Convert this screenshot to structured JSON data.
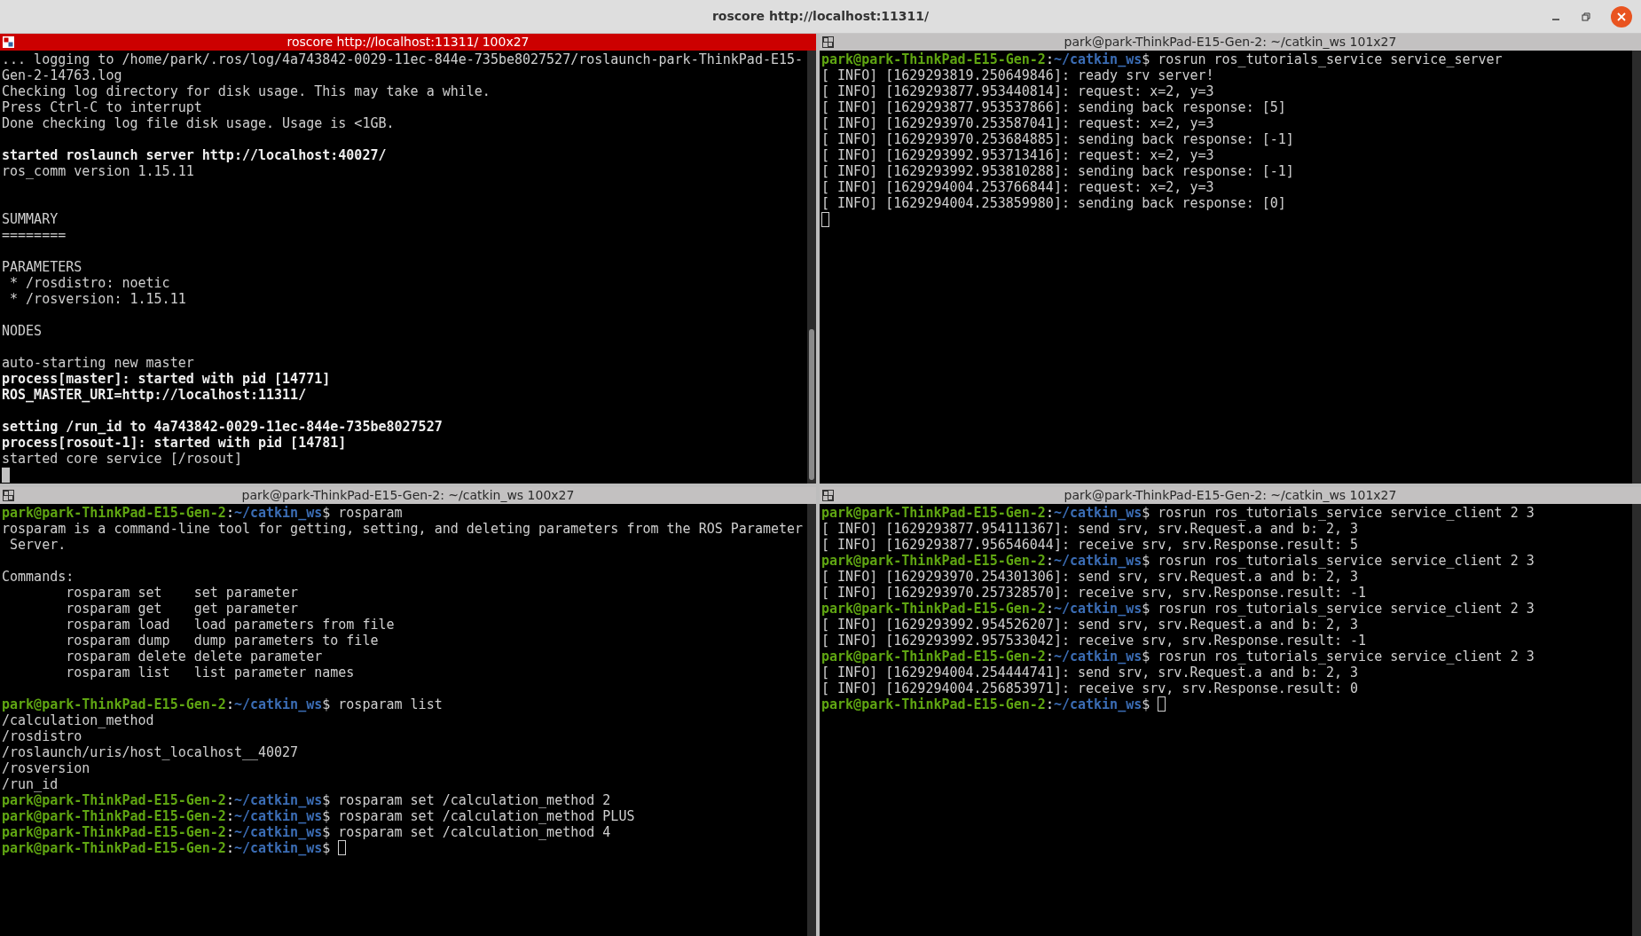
{
  "window": {
    "title": "roscore http://localhost:11311/"
  },
  "panes": [
    {
      "title": "roscore http://localhost:11311/ 100x27",
      "active": true,
      "scroll": true,
      "lines": [
        {
          "kind": "text",
          "text": "... logging to /home/park/.ros/log/4a743842-0029-11ec-844e-735be8027527/roslaunch-park-ThinkPad-E15-",
          "bold": false
        },
        {
          "kind": "text",
          "text": "Gen-2-14763.log",
          "bold": false
        },
        {
          "kind": "text",
          "text": "Checking log directory for disk usage. This may take a while.",
          "bold": false
        },
        {
          "kind": "text",
          "text": "Press Ctrl-C to interrupt",
          "bold": false
        },
        {
          "kind": "text",
          "text": "Done checking log file disk usage. Usage is <1GB.",
          "bold": false
        },
        {
          "kind": "blank"
        },
        {
          "kind": "text",
          "text": "started roslaunch server http://localhost:40027/",
          "bold": true
        },
        {
          "kind": "text",
          "text": "ros_comm version 1.15.11",
          "bold": false
        },
        {
          "kind": "blank"
        },
        {
          "kind": "blank"
        },
        {
          "kind": "text",
          "text": "SUMMARY",
          "bold": false
        },
        {
          "kind": "text",
          "text": "========",
          "bold": false
        },
        {
          "kind": "blank"
        },
        {
          "kind": "text",
          "text": "PARAMETERS",
          "bold": false
        },
        {
          "kind": "text",
          "text": " * /rosdistro: noetic",
          "bold": false
        },
        {
          "kind": "text",
          "text": " * /rosversion: 1.15.11",
          "bold": false
        },
        {
          "kind": "blank"
        },
        {
          "kind": "text",
          "text": "NODES",
          "bold": false
        },
        {
          "kind": "blank"
        },
        {
          "kind": "text",
          "text": "auto-starting new master",
          "bold": false
        },
        {
          "kind": "text",
          "text": "process[master]: started with pid [14771]",
          "bold": true
        },
        {
          "kind": "text",
          "text": "ROS_MASTER_URI=http://localhost:11311/",
          "bold": true
        },
        {
          "kind": "blank"
        },
        {
          "kind": "text",
          "text": "setting /run_id to 4a743842-0029-11ec-844e-735be8027527",
          "bold": true
        },
        {
          "kind": "text",
          "text": "process[rosout-1]: started with pid [14781]",
          "bold": true
        },
        {
          "kind": "text",
          "text": "started core service [/rosout]",
          "bold": false
        },
        {
          "kind": "cursor"
        }
      ]
    },
    {
      "title": "park@park-ThinkPad-E15-Gen-2: ~/catkin_ws 101x27",
      "active": false,
      "scroll": false,
      "lines": [
        {
          "kind": "prompt",
          "user": "park@park-ThinkPad-E15-Gen-2",
          "sep": ":",
          "path": "~/catkin_ws",
          "sign": "$",
          "command": " rosrun ros_tutorials_service service_server",
          "cursor": false
        },
        {
          "kind": "text",
          "text": "[ INFO] [1629293819.250649846]: ready srv server!",
          "bold": false
        },
        {
          "kind": "text",
          "text": "[ INFO] [1629293877.953440814]: request: x=2, y=3",
          "bold": false
        },
        {
          "kind": "text",
          "text": "[ INFO] [1629293877.953537866]: sending back response: [5]",
          "bold": false
        },
        {
          "kind": "text",
          "text": "[ INFO] [1629293970.253587041]: request: x=2, y=3",
          "bold": false
        },
        {
          "kind": "text",
          "text": "[ INFO] [1629293970.253684885]: sending back response: [-1]",
          "bold": false
        },
        {
          "kind": "text",
          "text": "[ INFO] [1629293992.953713416]: request: x=2, y=3",
          "bold": false
        },
        {
          "kind": "text",
          "text": "[ INFO] [1629293992.953810288]: sending back response: [-1]",
          "bold": false
        },
        {
          "kind": "text",
          "text": "[ INFO] [1629294004.253766844]: request: x=2, y=3",
          "bold": false
        },
        {
          "kind": "text",
          "text": "[ INFO] [1629294004.253859980]: sending back response: [0]",
          "bold": false
        },
        {
          "kind": "cursor"
        }
      ]
    },
    {
      "title": "park@park-ThinkPad-E15-Gen-2: ~/catkin_ws 100x27",
      "active": false,
      "scroll": false,
      "lines": [
        {
          "kind": "prompt",
          "user": "park@park-ThinkPad-E15-Gen-2",
          "sep": ":",
          "path": "~/catkin_ws",
          "sign": "$",
          "command": " rosparam",
          "cursor": false
        },
        {
          "kind": "text",
          "text": "rosparam is a command-line tool for getting, setting, and deleting parameters from the ROS Parameter",
          "bold": false
        },
        {
          "kind": "text",
          "text": " Server.",
          "bold": false
        },
        {
          "kind": "blank"
        },
        {
          "kind": "text",
          "text": "Commands:",
          "bold": false
        },
        {
          "kind": "text",
          "text": "        rosparam set    set parameter",
          "bold": false
        },
        {
          "kind": "text",
          "text": "        rosparam get    get parameter",
          "bold": false
        },
        {
          "kind": "text",
          "text": "        rosparam load   load parameters from file",
          "bold": false
        },
        {
          "kind": "text",
          "text": "        rosparam dump   dump parameters to file",
          "bold": false
        },
        {
          "kind": "text",
          "text": "        rosparam delete delete parameter",
          "bold": false
        },
        {
          "kind": "text",
          "text": "        rosparam list   list parameter names",
          "bold": false
        },
        {
          "kind": "blank"
        },
        {
          "kind": "prompt",
          "user": "park@park-ThinkPad-E15-Gen-2",
          "sep": ":",
          "path": "~/catkin_ws",
          "sign": "$",
          "command": " rosparam list",
          "cursor": false
        },
        {
          "kind": "text",
          "text": "/calculation_method",
          "bold": false
        },
        {
          "kind": "text",
          "text": "/rosdistro",
          "bold": false
        },
        {
          "kind": "text",
          "text": "/roslaunch/uris/host_localhost__40027",
          "bold": false
        },
        {
          "kind": "text",
          "text": "/rosversion",
          "bold": false
        },
        {
          "kind": "text",
          "text": "/run_id",
          "bold": false
        },
        {
          "kind": "prompt",
          "user": "park@park-ThinkPad-E15-Gen-2",
          "sep": ":",
          "path": "~/catkin_ws",
          "sign": "$",
          "command": " rosparam set /calculation_method 2",
          "cursor": false
        },
        {
          "kind": "prompt",
          "user": "park@park-ThinkPad-E15-Gen-2",
          "sep": ":",
          "path": "~/catkin_ws",
          "sign": "$",
          "command": " rosparam set /calculation_method PLUS",
          "cursor": false
        },
        {
          "kind": "prompt",
          "user": "park@park-ThinkPad-E15-Gen-2",
          "sep": ":",
          "path": "~/catkin_ws",
          "sign": "$",
          "command": " rosparam set /calculation_method 4",
          "cursor": false
        },
        {
          "kind": "prompt",
          "user": "park@park-ThinkPad-E15-Gen-2",
          "sep": ":",
          "path": "~/catkin_ws",
          "sign": "$",
          "cursor": true
        }
      ]
    },
    {
      "title": "park@park-ThinkPad-E15-Gen-2: ~/catkin_ws 101x27",
      "active": false,
      "scroll": false,
      "lines": [
        {
          "kind": "prompt",
          "user": "park@park-ThinkPad-E15-Gen-2",
          "sep": ":",
          "path": "~/catkin_ws",
          "sign": "$",
          "command": " rosrun ros_tutorials_service service_client 2 3",
          "cursor": false
        },
        {
          "kind": "text",
          "text": "[ INFO] [1629293877.954111367]: send srv, srv.Request.a and b: 2, 3",
          "bold": false
        },
        {
          "kind": "text",
          "text": "[ INFO] [1629293877.956546044]: receive srv, srv.Response.result: 5",
          "bold": false
        },
        {
          "kind": "prompt",
          "user": "park@park-ThinkPad-E15-Gen-2",
          "sep": ":",
          "path": "~/catkin_ws",
          "sign": "$",
          "command": " rosrun ros_tutorials_service service_client 2 3",
          "cursor": false
        },
        {
          "kind": "text",
          "text": "[ INFO] [1629293970.254301306]: send srv, srv.Request.a and b: 2, 3",
          "bold": false
        },
        {
          "kind": "text",
          "text": "[ INFO] [1629293970.257328570]: receive srv, srv.Response.result: -1",
          "bold": false
        },
        {
          "kind": "prompt",
          "user": "park@park-ThinkPad-E15-Gen-2",
          "sep": ":",
          "path": "~/catkin_ws",
          "sign": "$",
          "command": " rosrun ros_tutorials_service service_client 2 3",
          "cursor": false
        },
        {
          "kind": "text",
          "text": "[ INFO] [1629293992.954526207]: send srv, srv.Request.a and b: 2, 3",
          "bold": false
        },
        {
          "kind": "text",
          "text": "[ INFO] [1629293992.957533042]: receive srv, srv.Response.result: -1",
          "bold": false
        },
        {
          "kind": "prompt",
          "user": "park@park-ThinkPad-E15-Gen-2",
          "sep": ":",
          "path": "~/catkin_ws",
          "sign": "$",
          "command": " rosrun ros_tutorials_service service_client 2 3",
          "cursor": false
        },
        {
          "kind": "text",
          "text": "[ INFO] [1629294004.254444741]: send srv, srv.Request.a and b: 2, 3",
          "bold": false
        },
        {
          "kind": "text",
          "text": "[ INFO] [1629294004.256853971]: receive srv, srv.Response.result: 0",
          "bold": false
        },
        {
          "kind": "prompt",
          "user": "park@park-ThinkPad-E15-Gen-2",
          "sep": ":",
          "path": "~/catkin_ws",
          "sign": "$",
          "cursor": true
        }
      ]
    }
  ]
}
